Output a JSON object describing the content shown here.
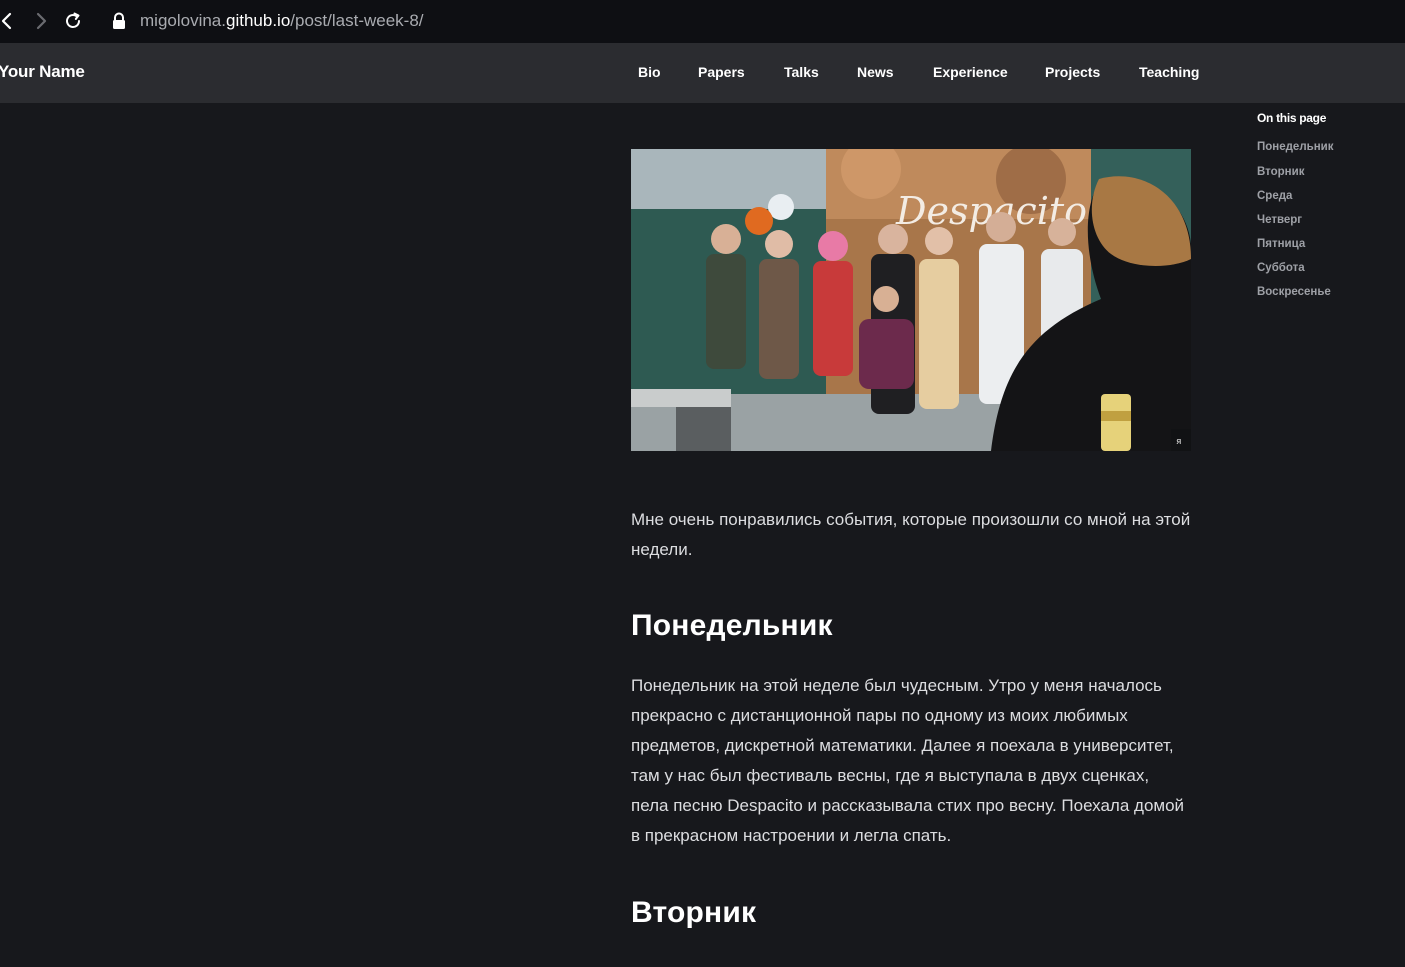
{
  "browser": {
    "url_host_prefix": "migolovina.",
    "url_host_main": "github.io",
    "url_path": "/post/last-week-8/"
  },
  "header": {
    "brand": "Your Name",
    "menu": [
      "Bio",
      "Papers",
      "Talks",
      "News",
      "Experience",
      "Projects",
      "Teaching"
    ]
  },
  "toc": {
    "title": "On this page",
    "items": [
      "Понедельник",
      "Вторник",
      "Среда",
      "Четверг",
      "Пятница",
      "Суббота",
      "Воскресенье"
    ]
  },
  "hero": {
    "screen_text": "Despacito",
    "corner_mark": "я"
  },
  "article": {
    "intro": "Мне очень понравились события, которые произошли со мной на этой недели.",
    "sections": [
      {
        "heading": "Понедельник",
        "text": "Понедельник на этой неделе был чудесным. Утро у меня началось прекрасно с дистанционной пары по одному из моих любимых предметов, дискретной математики. Далее я поехала в университет, там у нас был фестиваль весны, где я выступала в двух сценках, пела песню Despacito и рассказывала стих про весну. Поехала домой в прекрасном настроении и легла спать."
      },
      {
        "heading": "Вторник"
      }
    ]
  },
  "colors": {
    "page_bg": "#17181c",
    "header_bg": "#2b2c30",
    "browser_bg": "#0e0f13",
    "toc_muted": "#9ea0a6"
  }
}
